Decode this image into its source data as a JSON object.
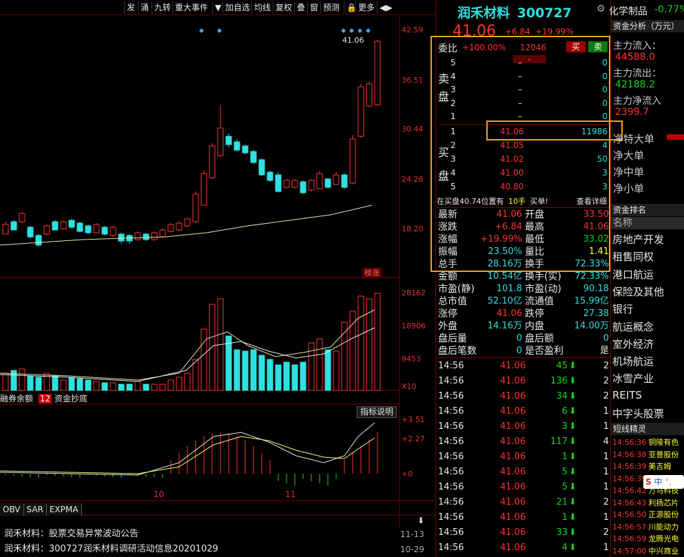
{
  "toolbar": {
    "items": [
      "发",
      "涌",
      "九转",
      "重大事件",
      "▼",
      "加自选",
      "均线",
      "复权",
      "叠",
      "窗",
      "预测",
      "🔒",
      "更多",
      "◀▶"
    ]
  },
  "stock": {
    "name": "润禾材料",
    "code": "300727",
    "price": "41.06",
    "change": "+6.84",
    "pct": "+19.99%"
  },
  "sector": {
    "name": "化学制品",
    "pct": "-0.77%"
  },
  "price_axis": [
    "42.59",
    "36.51",
    "30.44",
    "24.28",
    "18.20"
  ],
  "last_price_label": "41.06",
  "limit_badge": "榜涨",
  "volume_axis": [
    "28162",
    "18906",
    "9453",
    "X10"
  ],
  "indicator_tabs": {
    "tab1": "融券余额",
    "tab2_num": "12",
    "tab2": "资金抄底",
    "help": "指标说明"
  },
  "macd_axis": [
    "+3.51",
    "+2.27",
    "+0"
  ],
  "date_marks": [
    "10",
    "11"
  ],
  "bottom_tabs": [
    "OBV",
    "SAR",
    "EXPMA"
  ],
  "news": [
    {
      "title": "润禾材料：股票交易异常波动公告",
      "date": "11-13"
    },
    {
      "title": "润禾材料：300727润禾材料调研活动信息20201029",
      "date": "10-29"
    }
  ],
  "orderbook": {
    "ratio_label": "委比",
    "ratio": "+100.00%",
    "ratio_vol": "12046",
    "buy_btn": "买",
    "sell_btn": "卖",
    "sell_side_label": [
      "卖",
      "盘"
    ],
    "buy_side_label": [
      "买",
      "盘"
    ],
    "sells": [
      {
        "lvl": "5",
        "price": "–",
        "vol": "0"
      },
      {
        "lvl": "4",
        "price": "–",
        "vol": "0"
      },
      {
        "lvl": "3",
        "price": "–",
        "vol": "0"
      },
      {
        "lvl": "2",
        "price": "–",
        "vol": "0"
      },
      {
        "lvl": "1",
        "price": "–",
        "vol": "0"
      }
    ],
    "buys": [
      {
        "lvl": "1",
        "price": "41.06",
        "vol": "11986"
      },
      {
        "lvl": "2",
        "price": "41.05",
        "vol": "4"
      },
      {
        "lvl": "3",
        "price": "41.02",
        "vol": "50"
      },
      {
        "lvl": "4",
        "price": "41.00",
        "vol": "3"
      },
      {
        "lvl": "5",
        "price": "40.80",
        "vol": "3"
      }
    ],
    "notice_pre": "在买盘40.74位置有",
    "notice_num": "10手",
    "notice_post": "买单!",
    "notice_link": "查看详细"
  },
  "quote": [
    [
      "最新",
      "41.06",
      "开盘",
      "33.50"
    ],
    [
      "涨跌",
      "+6.84",
      "最高",
      "41.06"
    ],
    [
      "涨幅",
      "+19.99%",
      "最低",
      "33.02"
    ],
    [
      "振幅",
      "23.50%",
      "量比",
      "1.41"
    ],
    [
      "总手",
      "28.16万",
      "换手",
      "72.33%"
    ],
    [
      "金额",
      "10.54亿",
      "换手(实)",
      "72.33%"
    ],
    [
      "市盈(静)",
      "101.8",
      "市盈(动)",
      "90.18"
    ],
    [
      "总市值",
      "52.10亿",
      "流通值",
      "15.99亿"
    ],
    [
      "涨停",
      "41.06",
      "跌停",
      "27.38"
    ],
    [
      "外盘",
      "14.16万",
      "内盘",
      "14.00万"
    ],
    [
      "盘后量",
      "0",
      "盘后额",
      "0"
    ],
    [
      "盘后笔数",
      "0",
      "是否盈利",
      "是"
    ]
  ],
  "trades": [
    {
      "t": "14:56",
      "p": "41.06",
      "v": "45",
      "n": "2"
    },
    {
      "t": "14:56",
      "p": "41.06",
      "v": "136",
      "n": "2"
    },
    {
      "t": "14:56",
      "p": "41.06",
      "v": "34",
      "n": "2"
    },
    {
      "t": "14:56",
      "p": "41.06",
      "v": "6",
      "n": "1"
    },
    {
      "t": "14:56",
      "p": "41.06",
      "v": "3",
      "n": "1"
    },
    {
      "t": "14:56",
      "p": "41.06",
      "v": "117",
      "n": "4"
    },
    {
      "t": "14:56",
      "p": "41.06",
      "v": "1",
      "n": "1"
    },
    {
      "t": "14:56",
      "p": "41.06",
      "v": "5",
      "n": "1"
    },
    {
      "t": "14:56",
      "p": "41.06",
      "v": "5",
      "n": "1"
    },
    {
      "t": "14:56",
      "p": "41.06",
      "v": "21",
      "n": "2"
    },
    {
      "t": "14:56",
      "p": "41.06",
      "v": "1",
      "n": "1"
    },
    {
      "t": "14:56",
      "p": "41.06",
      "v": "33",
      "n": "2"
    },
    {
      "t": "14:56",
      "p": "41.06",
      "v": "4",
      "n": "1"
    }
  ],
  "fund": {
    "title": "资金分析（万元）",
    "inflow_label": "主力流入：",
    "inflow": "44588.0",
    "outflow_label": "主力流出：",
    "outflow": "42188.2",
    "net_label": "主力净流入",
    "net": "2399.7",
    "bars": [
      "净特大单",
      "净大单",
      "净中单",
      "净小单"
    ]
  },
  "rank": {
    "title": "资金排名",
    "col": "名称",
    "items": [
      "房地产开发",
      "租售同权",
      "港口航运",
      "保险及其他",
      "银行",
      "航运概念",
      "室外经济",
      "机场航运",
      "冰雪产业",
      "REITS",
      "中字头股票"
    ]
  },
  "elf": {
    "title": "短线精灵",
    "items": [
      {
        "t": "14:56:36",
        "n": "铜陵有色"
      },
      {
        "t": "14:56:38",
        "n": "亚普股份"
      },
      {
        "t": "14:56:39",
        "n": "美吉姆"
      },
      {
        "t": "14:56:39",
        "n": "铜陵有色"
      },
      {
        "t": "14:56:42",
        "n": "万马科技"
      },
      {
        "t": "14:56:43",
        "n": "利扬芯片"
      },
      {
        "t": "14:56:50",
        "n": "正源股份"
      },
      {
        "t": "14:56:57",
        "n": "川能动力"
      },
      {
        "t": "14:56:59",
        "n": "龙腾光电"
      },
      {
        "t": "14:57:00",
        "n": "中兴商业"
      }
    ],
    "ime": "中"
  }
}
